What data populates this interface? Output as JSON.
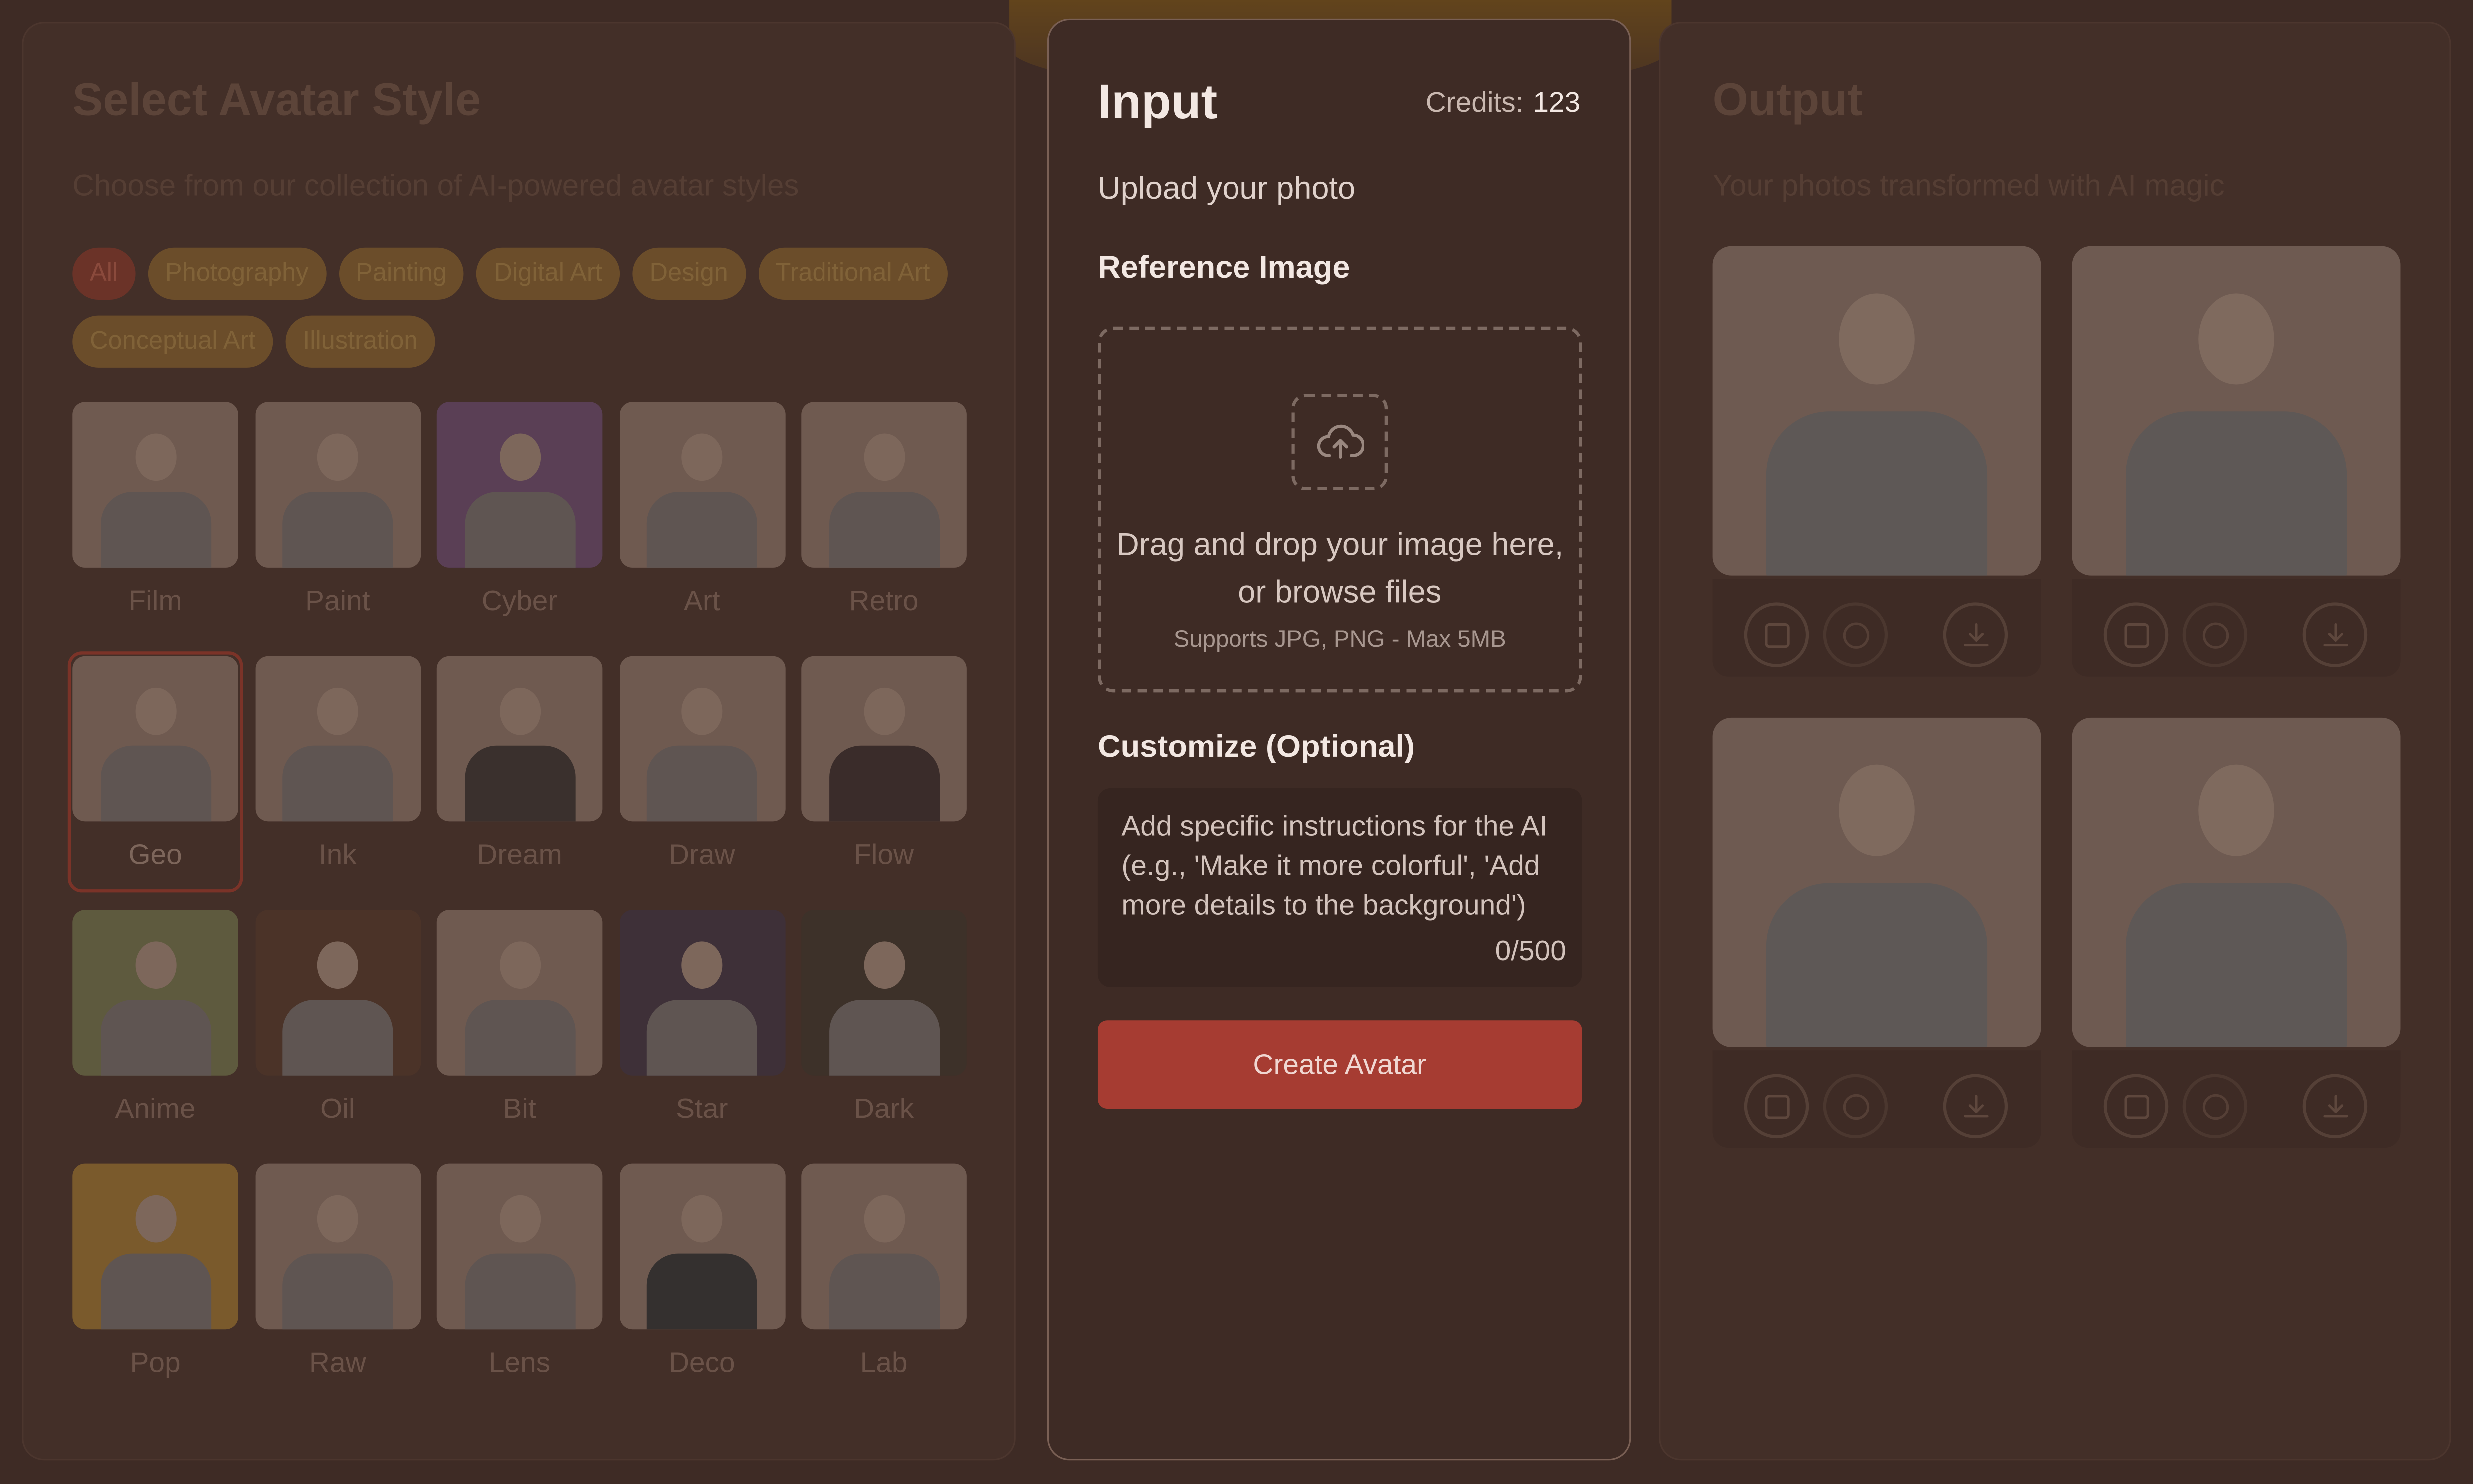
{
  "left_panel": {
    "title": "Select Avatar Style",
    "subtitle": "Choose from our collection of AI-powered avatar styles",
    "categories": [
      "All",
      "Photography",
      "Painting",
      "Digital Art",
      "Design",
      "Traditional Art",
      "Conceptual Art",
      "Illustration"
    ],
    "active_category": "All",
    "styles": [
      "Film",
      "Paint",
      "Cyber",
      "Art",
      "Retro",
      "Geo",
      "Ink",
      "Dream",
      "Draw",
      "Flow",
      "Anime",
      "Oil",
      "Bit",
      "Star",
      "Dark",
      "Pop",
      "Raw",
      "Lens",
      "Deco",
      "Lab"
    ],
    "selected_style": "Geo"
  },
  "input_panel": {
    "title": "Input",
    "credits_label": "Credits:",
    "credits_value": "123",
    "upload_label": "Upload your photo",
    "reference_label": "Reference Image",
    "drop_text": "Drag and drop your image here, or browse files",
    "drop_hint": "Supports JPG, PNG - Max 5MB",
    "customize_label": "Customize (Optional)",
    "customize_placeholder": "Add specific instructions for the AI (e.g., 'Make it more colorful', 'Add more details to the background')",
    "char_count": "0/500",
    "create_button": "Create Avatar"
  },
  "output_panel": {
    "title": "Output",
    "subtitle": "Your photos transformed with AI magic",
    "results": [
      {
        "actions": [
          "square-icon",
          "circle-icon",
          "download-icon"
        ]
      },
      {
        "actions": [
          "square-icon",
          "circle-icon",
          "download-icon"
        ]
      },
      {
        "actions": [
          "square-icon",
          "circle-icon",
          "download-icon"
        ]
      },
      {
        "actions": [
          "square-icon",
          "circle-icon",
          "download-icon"
        ]
      }
    ]
  },
  "colors": {
    "background": "#3e2b25",
    "accent_button": "#a63c32",
    "text_primary": "#f3e8e3"
  }
}
